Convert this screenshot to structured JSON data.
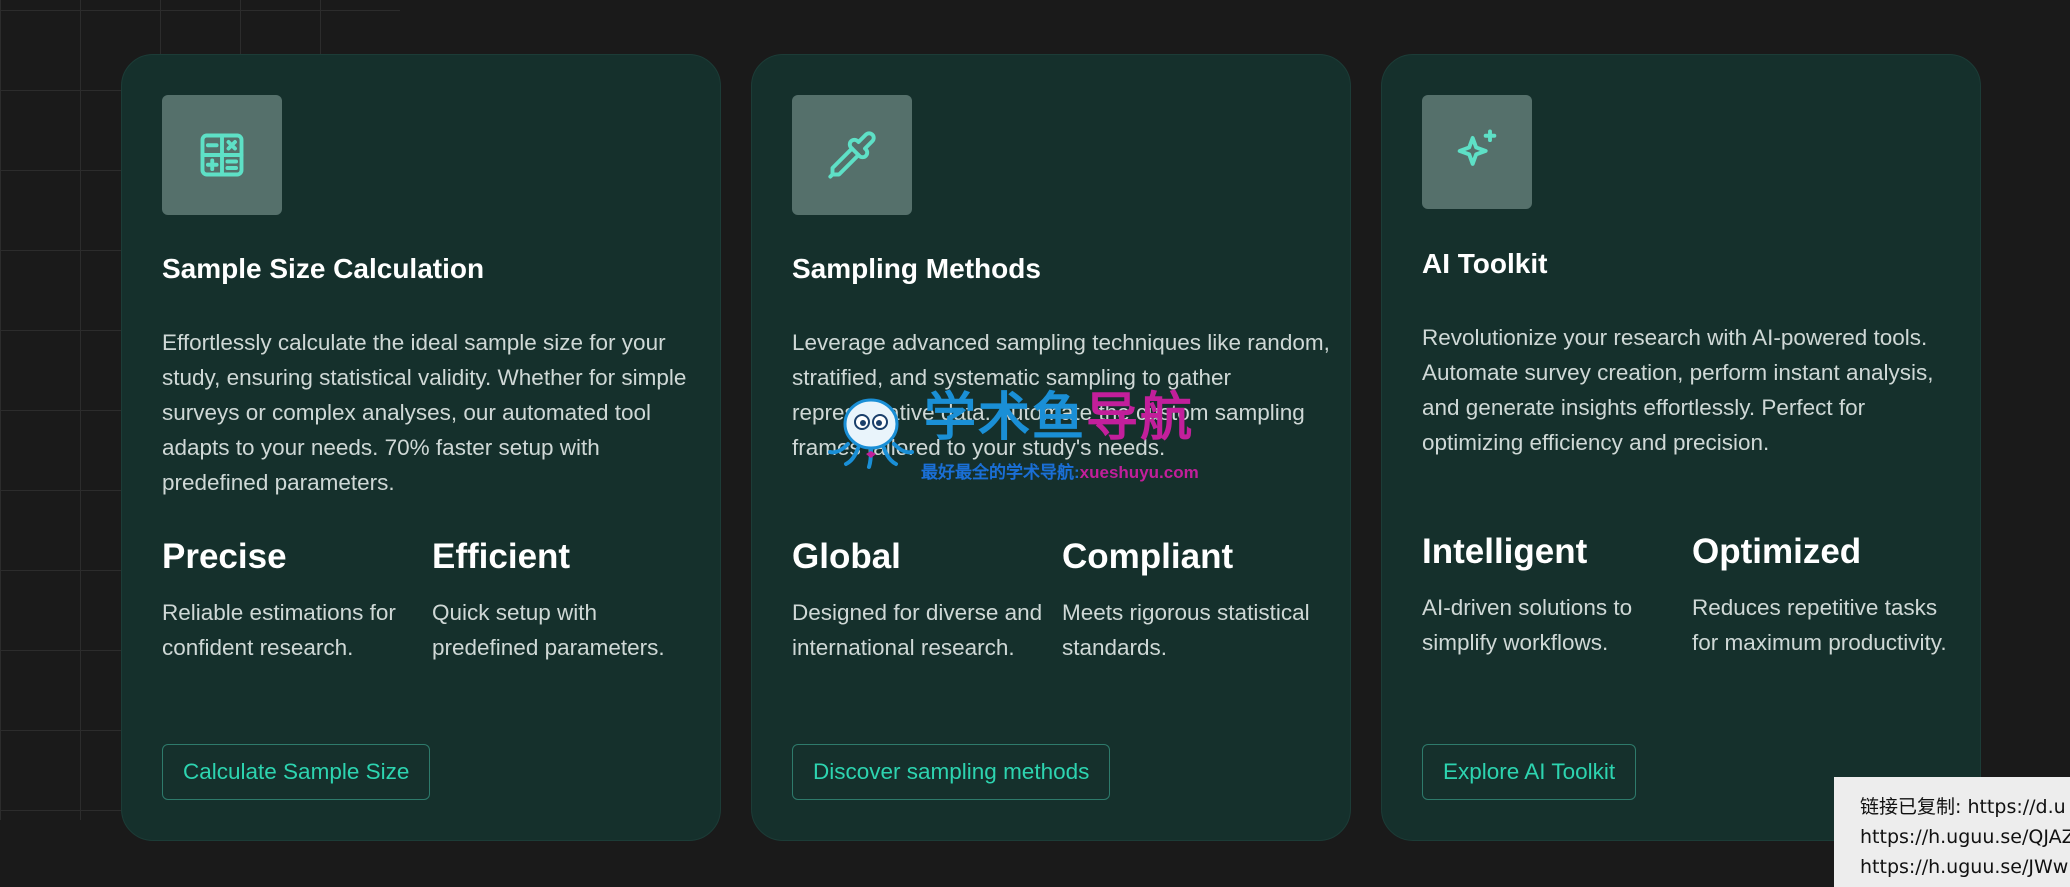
{
  "cards": [
    {
      "icon": "calculator-icon",
      "title": "Sample Size Calculation",
      "description": "Effortlessly calculate the ideal sample size for your study, ensuring statistical validity. Whether for simple surveys or complex analyses, our automated tool adapts to your needs. 70% faster setup with predefined parameters.",
      "stats": [
        {
          "value": "Precise",
          "label": "Reliable estimations for confident research."
        },
        {
          "value": "Efficient",
          "label": "Quick setup with predefined parameters."
        }
      ],
      "button": "Calculate Sample Size"
    },
    {
      "icon": "pipette-icon",
      "title": "Sampling Methods",
      "description": "Leverage advanced sampling techniques like random, stratified, and systematic sampling to gather representative data. Automate the custom sampling frames tailored to your study's needs.",
      "stats": [
        {
          "value": "Global",
          "label": "Designed for diverse and international research."
        },
        {
          "value": "Compliant",
          "label": "Meets rigorous statistical standards."
        }
      ],
      "button": "Discover sampling methods"
    },
    {
      "icon": "sparkles-icon",
      "title": "AI Toolkit",
      "description": "Revolutionize your research with AI-powered tools. Automate survey creation, perform instant analysis, and generate insights effortlessly. Perfect for optimizing efficiency and precision.",
      "stats": [
        {
          "value": "Intelligent",
          "label": "AI-driven solutions to simplify workflows."
        },
        {
          "value": "Optimized",
          "label": "Reduces repetitive tasks for maximum productivity."
        }
      ],
      "button": "Explore AI Toolkit"
    }
  ],
  "watermark": {
    "title_a": "学术鱼",
    "title_b": "导航",
    "subtitle": "最好最全的学术导航:",
    "domain": "xueshuyu.com"
  },
  "toast": {
    "lines": [
      "链接已复制: https://d.u",
      "https://h.uguu.se/QJAZ",
      "https://h.uguu.se/JWw"
    ]
  },
  "colors": {
    "page_bg": "#1a1a1a",
    "card_bg": "#15302c",
    "icon_box_bg": "#55706b",
    "accent": "#2dd4b0",
    "title": "#ffffff",
    "body_text": "#cfd8d6"
  }
}
